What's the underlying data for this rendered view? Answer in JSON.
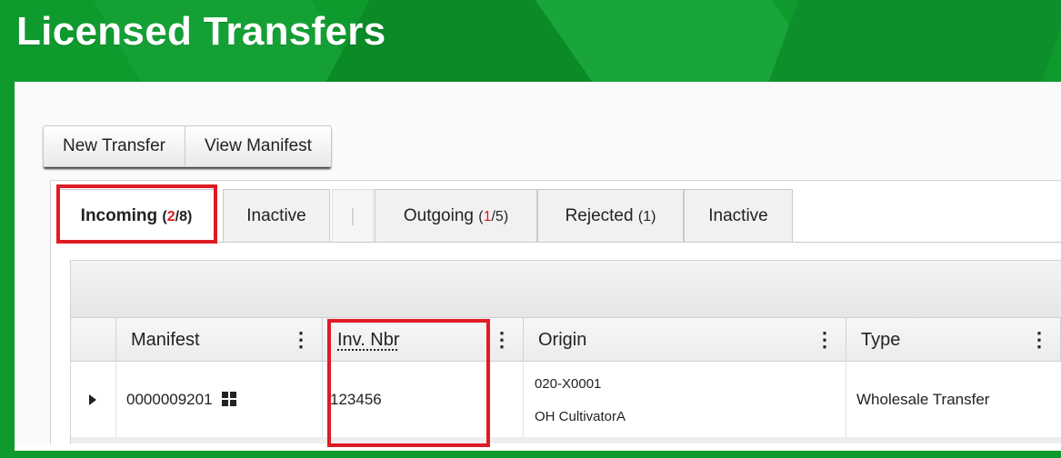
{
  "page": {
    "title": "Licensed Transfers"
  },
  "toolbar": {
    "new_transfer": "New Transfer",
    "view_manifest": "View Manifest"
  },
  "tabs": {
    "incoming": {
      "label": "Incoming",
      "open": "(",
      "count_red": "2",
      "count_rest": "/8)"
    },
    "inactive1": {
      "label": "Inactive"
    },
    "separator": "|",
    "outgoing": {
      "label": "Outgoing",
      "open": "(",
      "count_red": "1",
      "count_rest": "/5)"
    },
    "rejected": {
      "label": "Rejected",
      "count": "(1)"
    },
    "inactive2": {
      "label": "Inactive"
    }
  },
  "grid": {
    "columns": {
      "manifest": "Manifest",
      "inv_nbr": "Inv. Nbr",
      "origin": "Origin",
      "type": "Type"
    },
    "kebab": "⋮",
    "rows": [
      {
        "manifest": "0000009201",
        "inv_nbr": "123456",
        "origin_license": "020-X0001",
        "origin_name": "OH CultivatorA",
        "type": "Wholesale Transfer"
      }
    ]
  },
  "colors": {
    "header_green": "#0f9a2e",
    "highlight_red": "#e01b24"
  }
}
